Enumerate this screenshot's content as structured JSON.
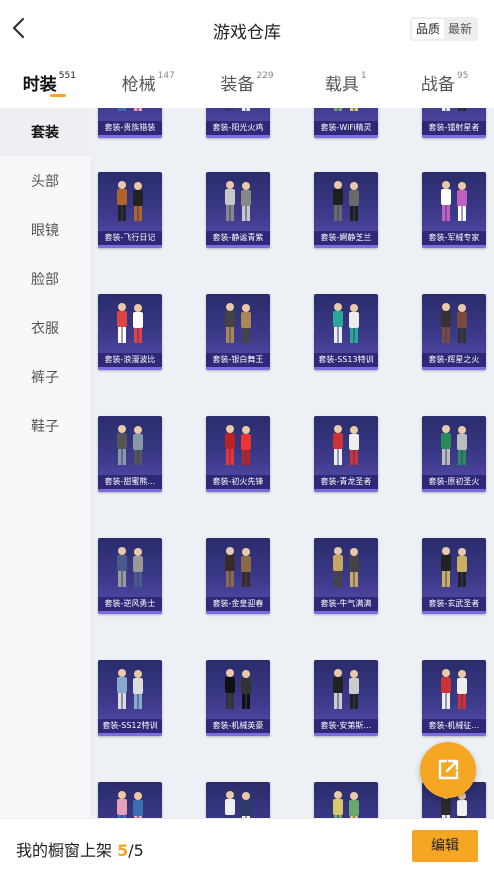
{
  "header": {
    "title": "游戏仓库",
    "sort_options": [
      "品质",
      "最新"
    ]
  },
  "tabs": [
    {
      "label": "时装",
      "count": "551"
    },
    {
      "label": "枪械",
      "count": "147"
    },
    {
      "label": "装备",
      "count": "229"
    },
    {
      "label": "载具",
      "count": "1"
    },
    {
      "label": "战备",
      "count": "95"
    }
  ],
  "sidebar": {
    "items": [
      "套装",
      "头部",
      "眼镜",
      "脸部",
      "衣服",
      "裤子",
      "鞋子"
    ]
  },
  "items": [
    {
      "name": "套装-贵族猎装"
    },
    {
      "name": "套装-阳光火鸡"
    },
    {
      "name": "套装-WiFi精灵"
    },
    {
      "name": "套装-镭射星者"
    },
    {
      "name": "套装-飞行日记"
    },
    {
      "name": "套装-静谧青紫"
    },
    {
      "name": "套装-婀静芝兰"
    },
    {
      "name": "套装-军械专家"
    },
    {
      "name": "套装-浪漫波比"
    },
    {
      "name": "套装-银白舞王"
    },
    {
      "name": "套装-SS13特训"
    },
    {
      "name": "套装-辉星之火"
    },
    {
      "name": "套装-甜蜜熊…"
    },
    {
      "name": "套装-初火先锋"
    },
    {
      "name": "套装-青龙圣者"
    },
    {
      "name": "套装-原初圣火"
    },
    {
      "name": "套装-逆风勇士"
    },
    {
      "name": "套装-金皇迎春"
    },
    {
      "name": "套装-牛气满满"
    },
    {
      "name": "套装-玄武圣者"
    },
    {
      "name": "套装-SS12特训"
    },
    {
      "name": "套装-机械英豪"
    },
    {
      "name": "套装-安第斯…"
    },
    {
      "name": "套装-机械征…"
    },
    {
      "name": ""
    },
    {
      "name": ""
    },
    {
      "name": ""
    },
    {
      "name": ""
    }
  ],
  "bottom": {
    "showcase_label": "我的橱窗上架",
    "showcase_count": "5",
    "showcase_total": "/5",
    "edit_label": "编辑"
  },
  "colors": {
    "accent": "#f5a623",
    "card_bg": "#3c3a8a"
  }
}
